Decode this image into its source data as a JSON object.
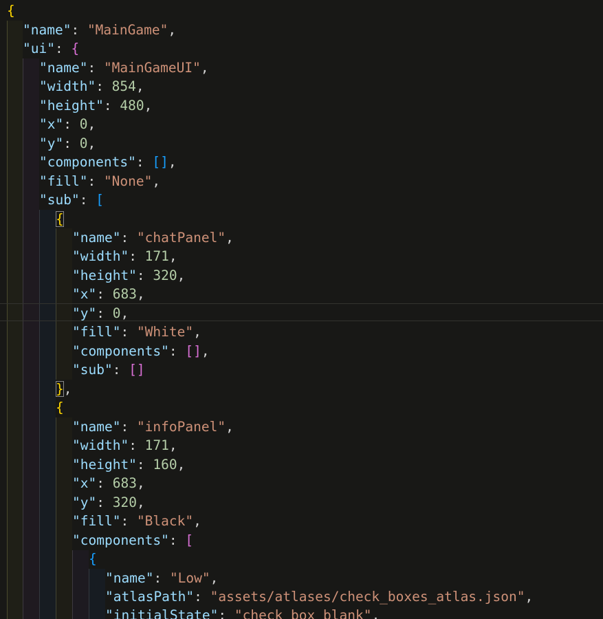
{
  "editor": {
    "theme_colors": {
      "background": "#181816",
      "key": "#9cdcfe",
      "string": "#ce9178",
      "number": "#b5cea8",
      "bracket_level1": "#ffd700",
      "bracket_level2": "#da70d6",
      "bracket_level3": "#179fff"
    },
    "lines": [
      [
        {
          "t": "{",
          "c": "b1"
        }
      ],
      [
        {
          "t": "\"name\"",
          "c": "k"
        },
        {
          "t": ": ",
          "c": "p"
        },
        {
          "t": "\"MainGame\"",
          "c": "s"
        },
        {
          "t": ",",
          "c": "p"
        }
      ],
      [
        {
          "t": "\"ui\"",
          "c": "k"
        },
        {
          "t": ": ",
          "c": "p"
        },
        {
          "t": "{",
          "c": "b2"
        }
      ],
      [
        {
          "t": "\"name\"",
          "c": "k"
        },
        {
          "t": ": ",
          "c": "p"
        },
        {
          "t": "\"MainGameUI\"",
          "c": "s"
        },
        {
          "t": ",",
          "c": "p"
        }
      ],
      [
        {
          "t": "\"width\"",
          "c": "k"
        },
        {
          "t": ": ",
          "c": "p"
        },
        {
          "t": "854",
          "c": "n"
        },
        {
          "t": ",",
          "c": "p"
        }
      ],
      [
        {
          "t": "\"height\"",
          "c": "k"
        },
        {
          "t": ": ",
          "c": "p"
        },
        {
          "t": "480",
          "c": "n"
        },
        {
          "t": ",",
          "c": "p"
        }
      ],
      [
        {
          "t": "\"x\"",
          "c": "k"
        },
        {
          "t": ": ",
          "c": "p"
        },
        {
          "t": "0",
          "c": "n"
        },
        {
          "t": ",",
          "c": "p"
        }
      ],
      [
        {
          "t": "\"y\"",
          "c": "k"
        },
        {
          "t": ": ",
          "c": "p"
        },
        {
          "t": "0",
          "c": "n"
        },
        {
          "t": ",",
          "c": "p"
        }
      ],
      [
        {
          "t": "\"components\"",
          "c": "k"
        },
        {
          "t": ": ",
          "c": "p"
        },
        {
          "t": "[]",
          "c": "b3"
        },
        {
          "t": ",",
          "c": "p"
        }
      ],
      [
        {
          "t": "\"fill\"",
          "c": "k"
        },
        {
          "t": ": ",
          "c": "p"
        },
        {
          "t": "\"None\"",
          "c": "s"
        },
        {
          "t": ",",
          "c": "p"
        }
      ],
      [
        {
          "t": "\"sub\"",
          "c": "k"
        },
        {
          "t": ": ",
          "c": "p"
        },
        {
          "t": "[",
          "c": "b3"
        }
      ],
      [
        {
          "t": "{",
          "c": "b1 bm"
        }
      ],
      [
        {
          "t": "\"name\"",
          "c": "k"
        },
        {
          "t": ": ",
          "c": "p"
        },
        {
          "t": "\"chatPanel\"",
          "c": "s"
        },
        {
          "t": ",",
          "c": "p"
        }
      ],
      [
        {
          "t": "\"width\"",
          "c": "k"
        },
        {
          "t": ": ",
          "c": "p"
        },
        {
          "t": "171",
          "c": "n"
        },
        {
          "t": ",",
          "c": "p"
        }
      ],
      [
        {
          "t": "\"height\"",
          "c": "k"
        },
        {
          "t": ": ",
          "c": "p"
        },
        {
          "t": "320",
          "c": "n"
        },
        {
          "t": ",",
          "c": "p"
        }
      ],
      [
        {
          "t": "\"x\"",
          "c": "k"
        },
        {
          "t": ": ",
          "c": "p"
        },
        {
          "t": "683",
          "c": "n"
        },
        {
          "t": ",",
          "c": "p"
        }
      ],
      [
        {
          "t": "\"y\"",
          "c": "k"
        },
        {
          "t": ": ",
          "c": "p"
        },
        {
          "t": "0",
          "c": "n"
        },
        {
          "t": ",",
          "c": "p"
        }
      ],
      [
        {
          "t": "\"fill\"",
          "c": "k"
        },
        {
          "t": ": ",
          "c": "p"
        },
        {
          "t": "\"White\"",
          "c": "s"
        },
        {
          "t": ",",
          "c": "p"
        }
      ],
      [
        {
          "t": "\"components\"",
          "c": "k"
        },
        {
          "t": ": ",
          "c": "p"
        },
        {
          "t": "[]",
          "c": "b2"
        },
        {
          "t": ",",
          "c": "p"
        }
      ],
      [
        {
          "t": "\"sub\"",
          "c": "k"
        },
        {
          "t": ": ",
          "c": "p"
        },
        {
          "t": "[]",
          "c": "b2"
        }
      ],
      [
        {
          "t": "}",
          "c": "b1 bm"
        },
        {
          "t": ",",
          "c": "p"
        }
      ],
      [
        {
          "t": "{",
          "c": "b1"
        }
      ],
      [
        {
          "t": "\"name\"",
          "c": "k"
        },
        {
          "t": ": ",
          "c": "p"
        },
        {
          "t": "\"infoPanel\"",
          "c": "s"
        },
        {
          "t": ",",
          "c": "p"
        }
      ],
      [
        {
          "t": "\"width\"",
          "c": "k"
        },
        {
          "t": ": ",
          "c": "p"
        },
        {
          "t": "171",
          "c": "n"
        },
        {
          "t": ",",
          "c": "p"
        }
      ],
      [
        {
          "t": "\"height\"",
          "c": "k"
        },
        {
          "t": ": ",
          "c": "p"
        },
        {
          "t": "160",
          "c": "n"
        },
        {
          "t": ",",
          "c": "p"
        }
      ],
      [
        {
          "t": "\"x\"",
          "c": "k"
        },
        {
          "t": ": ",
          "c": "p"
        },
        {
          "t": "683",
          "c": "n"
        },
        {
          "t": ",",
          "c": "p"
        }
      ],
      [
        {
          "t": "\"y\"",
          "c": "k"
        },
        {
          "t": ": ",
          "c": "p"
        },
        {
          "t": "320",
          "c": "n"
        },
        {
          "t": ",",
          "c": "p"
        }
      ],
      [
        {
          "t": "\"fill\"",
          "c": "k"
        },
        {
          "t": ": ",
          "c": "p"
        },
        {
          "t": "\"Black\"",
          "c": "s"
        },
        {
          "t": ",",
          "c": "p"
        }
      ],
      [
        {
          "t": "\"components\"",
          "c": "k"
        },
        {
          "t": ": ",
          "c": "p"
        },
        {
          "t": "[",
          "c": "b2"
        }
      ],
      [
        {
          "t": "{",
          "c": "b3"
        }
      ],
      [
        {
          "t": "\"name\"",
          "c": "k"
        },
        {
          "t": ": ",
          "c": "p"
        },
        {
          "t": "\"Low\"",
          "c": "s"
        },
        {
          "t": ",",
          "c": "p"
        }
      ],
      [
        {
          "t": "\"atlasPath\"",
          "c": "k"
        },
        {
          "t": ": ",
          "c": "p"
        },
        {
          "t": "\"assets/atlases/check_boxes_atlas.json\"",
          "c": "s"
        },
        {
          "t": ",",
          "c": "p"
        }
      ],
      [
        {
          "t": "\"initialState\"",
          "c": "k"
        },
        {
          "t": ": ",
          "c": "p"
        },
        {
          "t": "\"check_box_blank\"",
          "c": "s"
        },
        {
          "t": ",",
          "c": "p"
        }
      ]
    ]
  }
}
